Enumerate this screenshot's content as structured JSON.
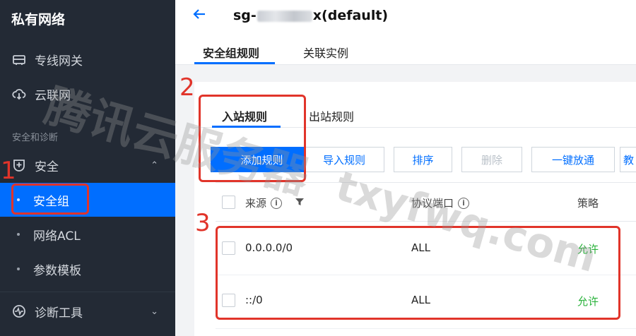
{
  "sidebar": {
    "title": "私有网络",
    "items": [
      {
        "label": "专线网关",
        "icon": "gateway-icon"
      },
      {
        "label": "云联网",
        "icon": "cloud-network-icon"
      }
    ],
    "section_label": "安全和诊断",
    "security_group": {
      "label": "安全",
      "icon": "security-shield-icon"
    },
    "sub_items": [
      {
        "label": "安全组",
        "active": true
      },
      {
        "label": "网络ACL",
        "active": false
      },
      {
        "label": "参数模板",
        "active": false
      }
    ],
    "diagnostic": {
      "label": "诊断工具",
      "icon": "diagnostic-icon"
    }
  },
  "header": {
    "title_prefix": "sg-",
    "title_suffix": "x(default)",
    "tabs": [
      {
        "label": "安全组规则",
        "active": true
      },
      {
        "label": "关联实例",
        "active": false
      }
    ]
  },
  "rules": {
    "tabs": [
      {
        "label": "入站规则",
        "active": true
      },
      {
        "label": "出站规则",
        "active": false
      }
    ],
    "buttons": {
      "add": "添加规则",
      "import": "导入规则",
      "sort": "排序",
      "delete": "删除",
      "one_click": "一键放通",
      "teach": "教"
    },
    "columns": {
      "source": "来源",
      "protocol_port": "协议端口",
      "policy": "策略"
    },
    "rows": [
      {
        "source": "0.0.0.0/0",
        "protocol_port": "ALL",
        "policy": "允许"
      },
      {
        "source": "::/0",
        "protocol_port": "ALL",
        "policy": "允许"
      }
    ]
  },
  "annotations": {
    "n1": "1",
    "n2": "2",
    "n3": "3"
  },
  "watermark": {
    "cn": "腾讯云服务器",
    "en": "txyfwq.com"
  },
  "colors": {
    "accent": "#006eff",
    "annotation": "#e1342a",
    "allow": "#29b23b",
    "sidebar_bg": "#232a35"
  }
}
